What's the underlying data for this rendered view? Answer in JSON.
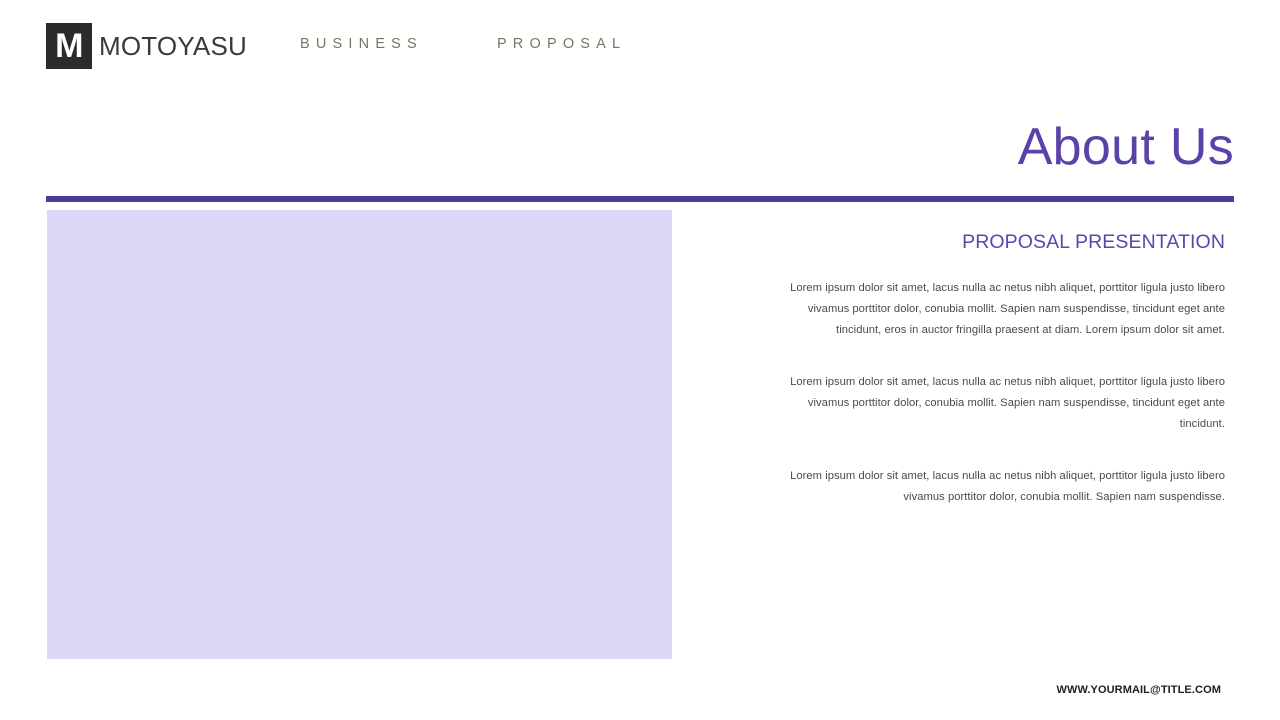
{
  "brand": {
    "mark_letter": "M",
    "name": "MOTOYASU"
  },
  "nav": {
    "items": [
      {
        "label": "BUSINESS"
      },
      {
        "label": "PROPOSAL"
      }
    ]
  },
  "title": {
    "text": "About Us"
  },
  "content": {
    "subtitle": "PROPOSAL PRESENTATION",
    "paragraphs": [
      "Lorem ipsum dolor sit amet, lacus nulla ac netus nibh aliquet, porttitor ligula justo libero vivamus porttitor dolor, conubia mollit. Sapien nam suspendisse, tincidunt eget ante tincidunt, eros in auctor fringilla praesent at diam. Lorem ipsum dolor sit amet.",
      "Lorem ipsum dolor sit amet, lacus nulla ac netus nibh aliquet, porttitor ligula justo libero vivamus porttitor dolor, conubia mollit. Sapien nam suspendisse, tincidunt eget ante tincidunt.",
      "Lorem ipsum dolor sit amet, lacus nulla ac netus nibh aliquet, porttitor ligula justo libero vivamus porttitor dolor, conubia mollit. Sapien nam suspendisse."
    ]
  },
  "footer": {
    "website": "WWW.YOURMAIL@TITLE.COM"
  },
  "colors": {
    "accent_title": "#5b42a8",
    "accent_rule": "#4b3d96",
    "accent_subtitle": "#5b46ab",
    "placeholder_fill": "#dcd7f7",
    "nav_text": "#6f7a63",
    "body_text": "#4a4a4a",
    "brand_mark_bg": "#2b2b2b"
  }
}
